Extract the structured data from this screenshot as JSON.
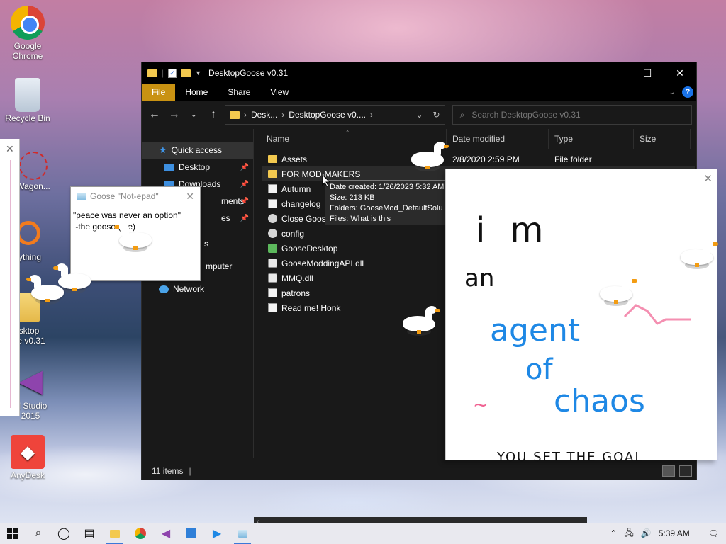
{
  "desktop": {
    "icons": [
      {
        "label": "Google\nChrome",
        "icon": "chrome-icon"
      },
      {
        "label": "Recycle Bin",
        "icon": "recycle-bin-icon"
      },
      {
        "label": "Wagon...",
        "icon": "web-icon"
      },
      {
        "label": "rything",
        "icon": "everything-icon"
      },
      {
        "label": "sktop\nse v0.31",
        "icon": "folder-icon"
      },
      {
        "label": "al Studio\n2015",
        "icon": "visual-studio-icon"
      },
      {
        "label": "AnyDesk",
        "icon": "anydesk-icon"
      }
    ]
  },
  "explorer": {
    "title": "DesktopGoose v0.31",
    "window_controls": {
      "minimize": "—",
      "maximize": "☐",
      "close": "✕"
    },
    "ribbon_tabs": [
      "File",
      "Home",
      "Share",
      "View"
    ],
    "address": {
      "part1": "Desk...",
      "part2": "DesktopGoose v0....",
      "sep": "›"
    },
    "search_placeholder": "Search DesktopGoose v0.31",
    "nav_items": [
      {
        "label": "Quick access"
      },
      {
        "label": "Desktop"
      },
      {
        "label": "Downloads"
      },
      {
        "label": "ments"
      },
      {
        "label": "es"
      },
      {
        "label": "s"
      },
      {
        "label": "mputer"
      },
      {
        "label": "Network"
      }
    ],
    "columns": {
      "name": "Name",
      "date": "Date modified",
      "type": "Type",
      "size": "Size"
    },
    "files": [
      {
        "name": "Assets",
        "date": "2/8/2020 2:59 PM",
        "type": "File folder",
        "icon": "folder"
      },
      {
        "name": "FOR MOD-MAKERS",
        "date": "",
        "type": "",
        "icon": "folder"
      },
      {
        "name": "Autumn",
        "date": "",
        "type": "",
        "icon": "doc"
      },
      {
        "name": "changelog",
        "date": "",
        "type": "",
        "icon": "doc"
      },
      {
        "name": "Close Goose",
        "date": "",
        "type": "",
        "icon": "gear"
      },
      {
        "name": "config",
        "date": "",
        "type": "",
        "icon": "gear"
      },
      {
        "name": "GooseDesktop",
        "date": "",
        "type": "",
        "icon": "app"
      },
      {
        "name": "GooseModdingAPI.dll",
        "date": "",
        "type": "",
        "icon": "dll"
      },
      {
        "name": "MMQ.dll",
        "date": "",
        "type": "",
        "icon": "dll"
      },
      {
        "name": "patrons",
        "date": "",
        "type": "",
        "icon": "doc"
      },
      {
        "name": "Read me! Honk",
        "date": "",
        "type": "",
        "icon": "doc"
      }
    ],
    "status": "11 items",
    "tooltip": [
      "Date created: 1/26/2023 5:32 AM",
      "Size: 213 KB",
      "Folders: GooseMod_DefaultSolu",
      "Files: What is this"
    ]
  },
  "notepad": {
    "title": "Goose \"Not-epad\"",
    "line1": "\"peace was never an option\"",
    "line2": " -the goose (me)"
  },
  "drawing": {
    "words": [
      "i m",
      "an",
      "agent",
      "of",
      "chaos",
      "YOU SET THE GOAL"
    ]
  },
  "taskbar": {
    "time": "5:39 AM"
  }
}
